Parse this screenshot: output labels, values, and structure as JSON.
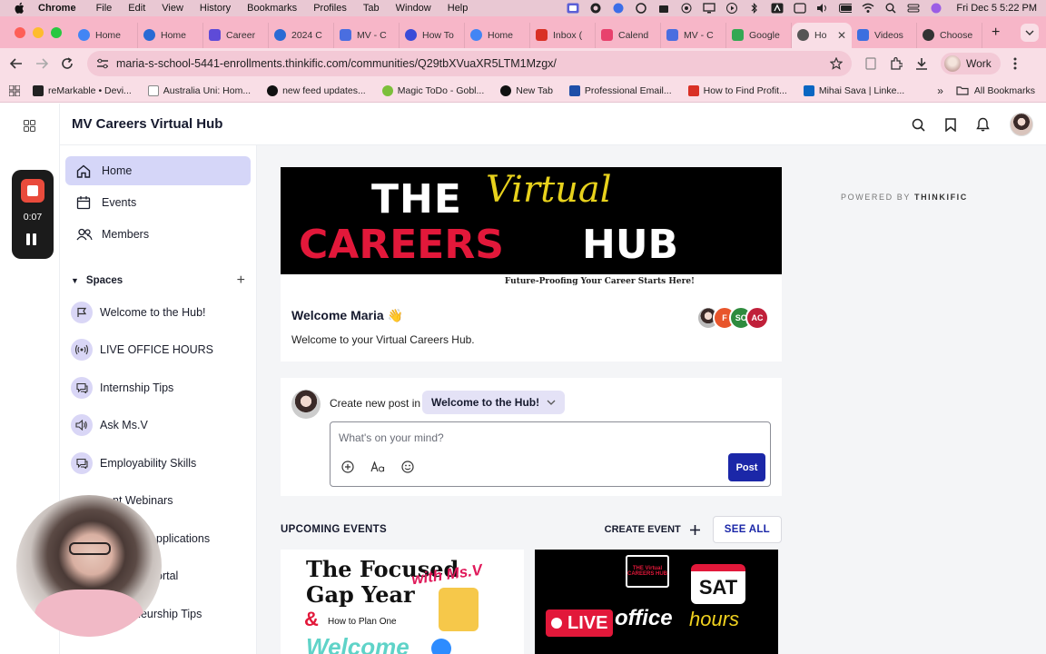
{
  "menubar": {
    "app": "Chrome",
    "items": [
      "File",
      "Edit",
      "View",
      "History",
      "Bookmarks",
      "Profiles",
      "Tab",
      "Window",
      "Help"
    ],
    "datetime": "Fri Dec 5  5:22 PM"
  },
  "tabs": [
    {
      "label": "Home",
      "color": "#4285f4"
    },
    {
      "label": "Home",
      "color": "#2a6ad4"
    },
    {
      "label": "Career",
      "color": "#5e4bd8"
    },
    {
      "label": "2024 C",
      "color": "#2a6ad4"
    },
    {
      "label": "MV - C",
      "color": "#4a6ee0"
    },
    {
      "label": "How To",
      "color": "#3b4bd8"
    },
    {
      "label": "Home",
      "color": "#4285f4"
    },
    {
      "label": "Inbox (",
      "color": "#d93025"
    },
    {
      "label": "Calend",
      "color": "#e8416d"
    },
    {
      "label": "MV - C",
      "color": "#4a6ee0"
    },
    {
      "label": "Google",
      "color": "#34a853"
    },
    {
      "label": "Ho",
      "color": "#555555",
      "active": true
    },
    {
      "label": "Videos",
      "color": "#3c6fe0"
    },
    {
      "label": "Choose",
      "color": "#333333"
    }
  ],
  "address": {
    "url": "maria-s-school-5441-enrollments.thinkific.com/communities/Q29tbXVuaXR5LTM1Mzgx/",
    "profile": "Work"
  },
  "bookmarks": [
    {
      "label": "reMarkable • Devi...",
      "color": "#222222"
    },
    {
      "label": "Australia Uni: Hom...",
      "color": "#888888"
    },
    {
      "label": "new feed updates...",
      "color": "#111111"
    },
    {
      "label": "Magic ToDo - Gobl...",
      "color": "#7cbf3a"
    },
    {
      "label": "New Tab",
      "color": "#111111"
    },
    {
      "label": "Professional Email...",
      "color": "#1e4ea8"
    },
    {
      "label": "How to Find Profit...",
      "color": "#d93025"
    },
    {
      "label": "Mihai Sava | Linke...",
      "color": "#0a66c2"
    }
  ],
  "bookmarks_all": "All Bookmarks",
  "site": {
    "title": "MV Careers Virtual Hub",
    "powered_by": "POWERED BY",
    "powered_brand": "THINKIFIC"
  },
  "nav": {
    "home": "Home",
    "events": "Events",
    "members": "Members",
    "spaces_heading": "Spaces"
  },
  "spaces": [
    {
      "label": "Welcome to the Hub!",
      "icon": "flag-icon"
    },
    {
      "label": "LIVE OFFICE HOURS",
      "icon": "broadcast-icon"
    },
    {
      "label": "Internship Tips",
      "icon": "chat-icon"
    },
    {
      "label": "Ask Ms.V",
      "icon": "speaker-icon"
    },
    {
      "label": "Employability Skills",
      "icon": "chat-icon"
    },
    {
      "label": "nt Webinars",
      "icon": "chat-icon"
    },
    {
      "label": "pplications",
      "icon": "chat-icon"
    },
    {
      "label": "ortal",
      "icon": "chat-icon"
    },
    {
      "label": "neurship Tips",
      "icon": "chat-icon"
    }
  ],
  "banner": {
    "the": "THE",
    "virtual": "Virtual",
    "careers": "CAREERS",
    "hub": "HUB",
    "tagline": "Future-Proofing Your Career Starts Here!"
  },
  "welcome": {
    "title": "Welcome Maria 👋",
    "subtitle": "Welcome to your Virtual Careers Hub.",
    "member_avatars": [
      {
        "initials": "",
        "color": "#6b5a55"
      },
      {
        "initials": "F",
        "color": "#e8552b"
      },
      {
        "initials": "SC",
        "color": "#2e8b3e"
      },
      {
        "initials": "AC",
        "color": "#c0203a"
      }
    ]
  },
  "composer": {
    "create_label": "Create new post in",
    "selected_space": "Welcome to the Hub!",
    "placeholder": "What's on your mind?",
    "post_label": "Post"
  },
  "events": {
    "heading": "UPCOMING EVENTS",
    "create_label": "CREATE EVENT",
    "see_all": "SEE ALL",
    "card1": {
      "title_line1": "The Focused",
      "title_line2": "Gap Year",
      "with": "with Ms.V",
      "amp": "&",
      "how": "How to Plan One",
      "welcome": "Welcome"
    },
    "card2": {
      "sign": "THE Virtual CAREERS HUB",
      "sat": "SAT",
      "live": "LIVE",
      "office": "office",
      "hours": "hours"
    }
  },
  "recording": {
    "time": "0:07"
  }
}
